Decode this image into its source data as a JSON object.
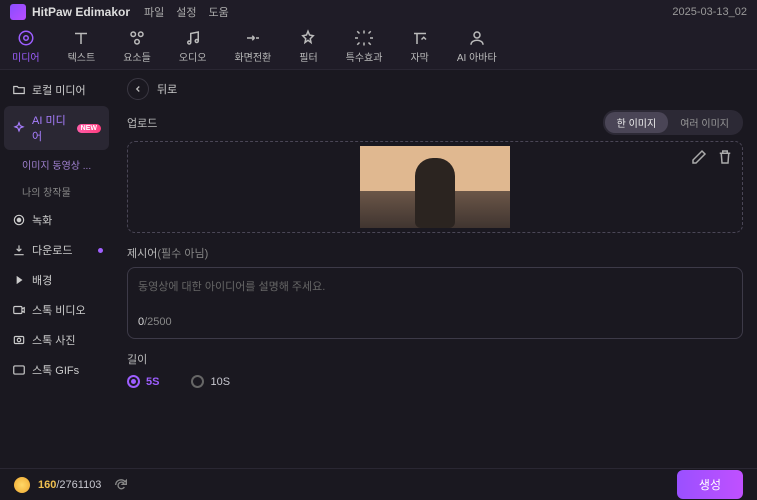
{
  "titlebar": {
    "appname": "HitPaw Edimakor",
    "menu": {
      "file": "파일",
      "settings": "설정",
      "help": "도움"
    },
    "date": "2025-03-13_02"
  },
  "toolbar": {
    "media": "미디어",
    "text": "텍스트",
    "elements": "요소들",
    "audio": "오디오",
    "transition": "화면전환",
    "filter": "필터",
    "effects": "특수효과",
    "subtitle": "자막",
    "ai_avatar": "AI 아바타"
  },
  "sidebar": {
    "local_media": "로컬 미디어",
    "ai_media": "AI 미디어",
    "ai_media_badge": "NEW",
    "sub_image_to_video": "이미지 동영상 ...",
    "sub_my_creations": "나의 창작물",
    "record": "녹화",
    "download": "다운로드",
    "background": "배경",
    "stock_video": "스톡 비디오",
    "stock_photo": "스톡 사진",
    "stock_gifs": "스톡 GIFs"
  },
  "main": {
    "back": "뒤로",
    "upload_label": "업로드",
    "pill_single": "한 이미지",
    "pill_multi": "여러 이미지",
    "prompt_label": "제시어",
    "prompt_optional": "(필수 아님)",
    "prompt_placeholder": "동영상에 대한 아이디어를 설명해 주세요.",
    "char_current": "0",
    "char_max": "/2500",
    "length_label": "길이",
    "length_5s": "5S",
    "length_10s": "10S"
  },
  "footer": {
    "credits_current": "160",
    "credits_max": "/2761103",
    "generate": "생성"
  }
}
